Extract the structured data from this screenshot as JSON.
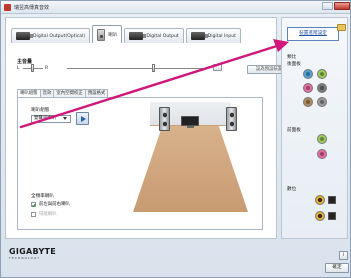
{
  "window": {
    "title": "瑞昱高傳真音效"
  },
  "device_tabs": [
    {
      "label": "Digital Output(Optical)"
    },
    {
      "label": "喇叭"
    },
    {
      "label": "Digital Output"
    },
    {
      "label": "Digital Input"
    }
  ],
  "volume": {
    "label": "主音量",
    "left": "L",
    "right": "R",
    "default_device_button": "設為預設裝置",
    "balance_level": 0.5,
    "volume_level": 0.65
  },
  "sub_tabs": [
    "喇叭組態",
    "音效",
    "室內空間校正",
    "預設格式"
  ],
  "speaker_config": {
    "label": "喇叭組態",
    "selected": "雙聲道喇叭"
  },
  "full_range": {
    "label": "全頻率喇叭",
    "options": [
      {
        "label": "前左與前右喇叭",
        "checked": true,
        "enabled": true
      },
      {
        "label": "環繞喇叭",
        "checked": false,
        "enabled": false
      }
    ]
  },
  "side": {
    "advanced_link": "裝置進階設定",
    "analog_label": "類比",
    "back_panel_label": "後面板",
    "front_panel_label": "前面板",
    "digital_label": "數位",
    "rear_jacks": [
      "#4ea3d8",
      "#9acd5a",
      "#e96aa0",
      "#7a7a7a",
      "#b08a5a",
      "#9a9a9a"
    ],
    "front_jacks": [
      "#9acd5a",
      "#e96aa0"
    ]
  },
  "footer": {
    "logo": "GIGABYTE",
    "logo_sub": "TECHNOLOGY",
    "info_button": "i",
    "ok_button": "確定"
  }
}
